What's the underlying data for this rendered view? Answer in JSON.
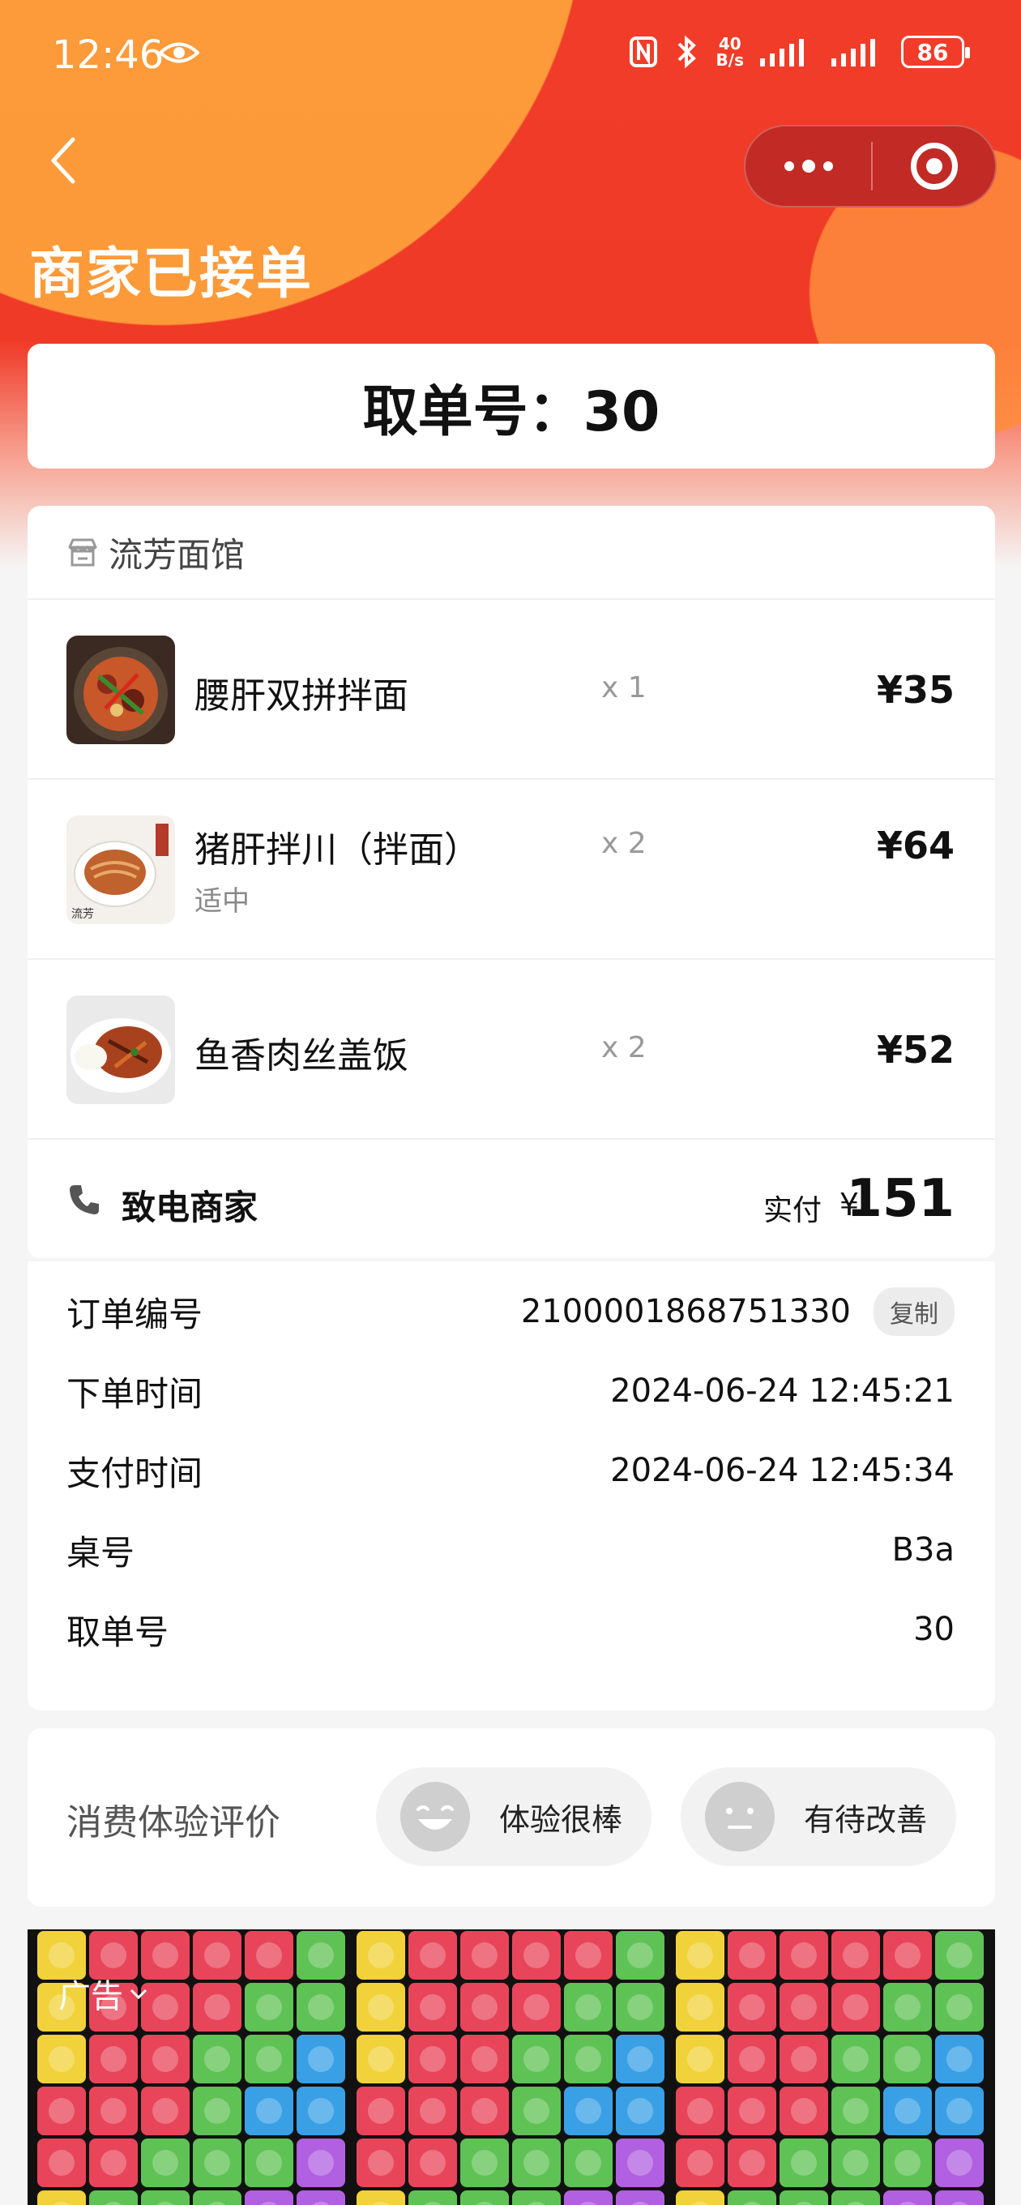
{
  "status_bar": {
    "time": "12:46",
    "network_speed_top": "40",
    "network_speed_bottom": "B/s",
    "battery": "86"
  },
  "header": {
    "title": "商家已接单",
    "pickup_text": "取单号：30"
  },
  "shop": {
    "name": "流芳面馆"
  },
  "items": [
    {
      "name": "腰肝双拼拌面",
      "spec": "",
      "qty": "x 1",
      "price": "¥35"
    },
    {
      "name": "猪肝拌川（拌面）",
      "spec": "适中",
      "qty": "x 2",
      "price": "¥64"
    },
    {
      "name": "鱼香肉丝盖饭",
      "spec": "",
      "qty": "x 2",
      "price": "¥52"
    }
  ],
  "payment": {
    "call_label": "致电商家",
    "paid_label": "实付",
    "currency": "¥",
    "total": "151"
  },
  "details": [
    {
      "key": "订单编号",
      "value": "2100001868751330",
      "action": "复制"
    },
    {
      "key": "下单时间",
      "value": "2024-06-24 12:45:21"
    },
    {
      "key": "支付时间",
      "value": "2024-06-24 12:45:34"
    },
    {
      "key": "桌号",
      "value": "B3a"
    },
    {
      "key": "取单号",
      "value": "30"
    }
  ],
  "rating": {
    "label": "消费体验评价",
    "good": "体验很棒",
    "bad": "有待改善"
  },
  "ad": {
    "label": "广告"
  },
  "colors": {
    "header_red": "#ef3a27",
    "header_orange": "#ffaa3c",
    "background": "#f5f5f5"
  }
}
